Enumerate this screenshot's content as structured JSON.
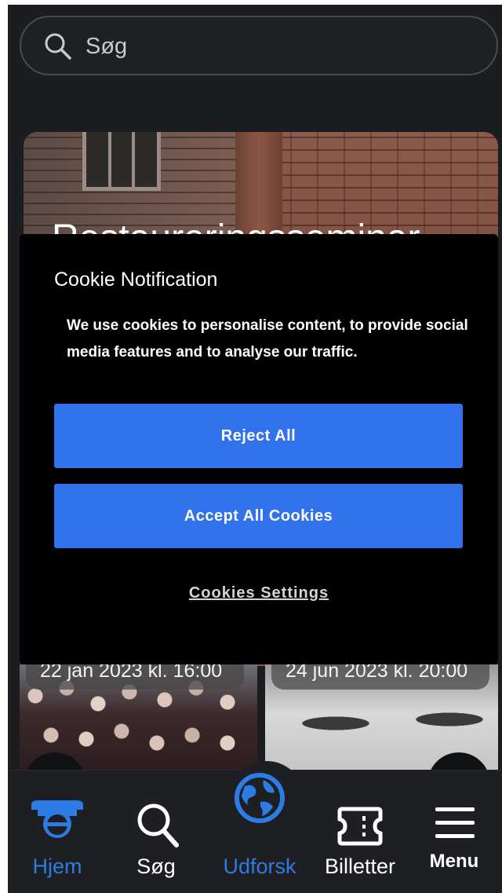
{
  "search": {
    "placeholder": "Søg"
  },
  "hero": {
    "title": "Restaureringsseminar"
  },
  "events": [
    {
      "date": "22 jan 2023 kl. 16:00"
    },
    {
      "date": "24 jun 2023 kl. 20:00"
    }
  ],
  "carousel": {
    "prev": "‹",
    "next": "›"
  },
  "cookie": {
    "title": "Cookie Notification",
    "text": "We use cookies to personalise content, to provide social media features and to analyse our traffic.",
    "reject_label": "Reject All",
    "accept_label": "Accept All Cookies",
    "settings_label": "Cookies Settings"
  },
  "nav": {
    "items": [
      {
        "label": "Hjem",
        "icon": "home-icon",
        "active": true
      },
      {
        "label": "Søg",
        "icon": "search-icon",
        "active": false
      },
      {
        "label": "Udforsk",
        "icon": "globe-icon",
        "active": true
      },
      {
        "label": "Billetter",
        "icon": "ticket-icon",
        "active": false
      },
      {
        "label": "Menu",
        "icon": "hamburger-menu-icon",
        "active": false
      }
    ]
  },
  "colors": {
    "accent": "#2f72eb",
    "nav_active": "#2d7be4",
    "background": "#1c1d20",
    "modal": "#000000"
  }
}
